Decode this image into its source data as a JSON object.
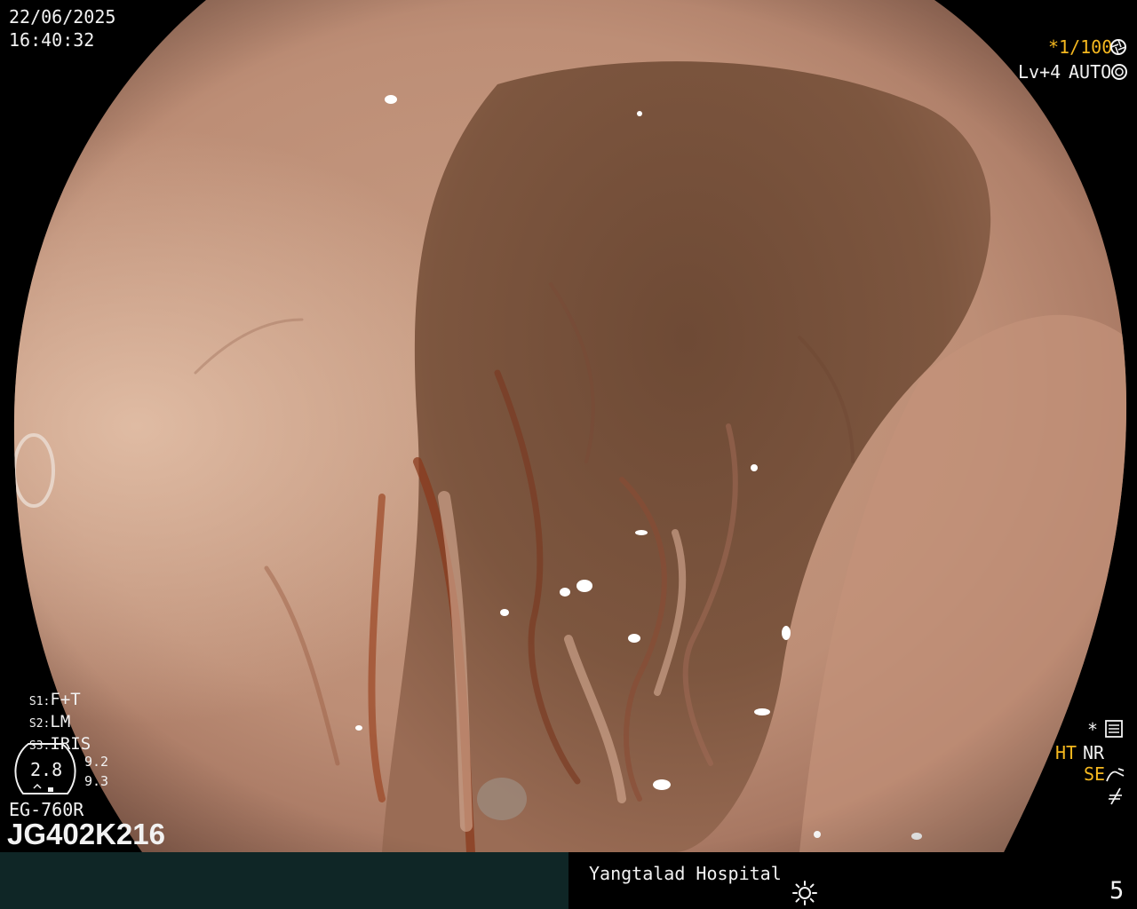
{
  "overlay": {
    "date": "22/06/2025",
    "time": "16:40:32",
    "shutter": "*1/100",
    "light_level": "Lv+4",
    "mode": "AUTO",
    "settings": [
      {
        "key": "S1:",
        "value": "F+T"
      },
      {
        "key": "S2:",
        "value": "LM"
      },
      {
        "key": "S3:",
        "value": "IRIS"
      }
    ],
    "scope_gauge": "2.8",
    "gauge_readings": [
      "9.2",
      "9.3"
    ],
    "scope_model": "EG-760R",
    "scope_serial": "JG402K216",
    "right_flags": {
      "star": "*",
      "ht": "HT",
      "nr": "NR",
      "se": "SE",
      "arrow": "⌠"
    },
    "hospital": "Yangtalad Hospital",
    "page_number": "5",
    "colors": {
      "highlight": "#f5b81f",
      "text": "#f2f2f2",
      "bar": "#0f2626"
    },
    "icons": [
      "aperture-icon",
      "auto-iris-icon",
      "menu-settings-icon",
      "bend-arrow-icon",
      "flash-icon",
      "brightness-icon"
    ]
  }
}
